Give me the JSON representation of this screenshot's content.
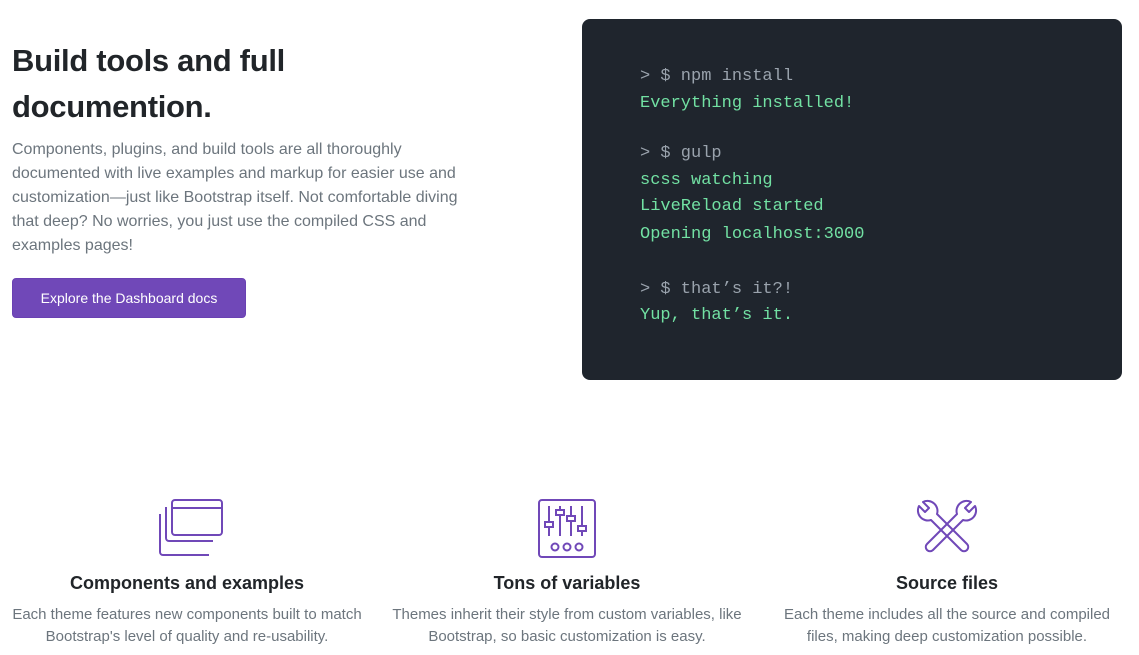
{
  "hero": {
    "title": "Build tools and full documention.",
    "description": "Components, plugins, and build tools are all thoroughly documented with live examples and markup for easier use and customization—just like Bootstrap itself. Not comfortable diving that deep? No worries, you just use the compiled CSS and examples pages!",
    "button_label": "Explore the Dashboard docs"
  },
  "terminal": {
    "lines": [
      {
        "kind": "cmd",
        "text": "> $ npm install"
      },
      {
        "kind": "out",
        "text": "Everything installed!"
      },
      {
        "kind": "cmd",
        "text": "> $ gulp"
      },
      {
        "kind": "out",
        "text": "scss watching"
      },
      {
        "kind": "out",
        "text": "LiveReload started"
      },
      {
        "kind": "out",
        "text": "Opening localhost:3000"
      },
      {
        "kind": "cmd",
        "text": "> $ that’s it?!"
      },
      {
        "kind": "out",
        "text": "Yup, that’s it."
      }
    ]
  },
  "features": [
    {
      "icon": "stacked-windows-icon",
      "title": "Components and examples",
      "text": "Each theme features new components built to match Bootstrap's level of quality and re-usability."
    },
    {
      "icon": "sliders-icon",
      "title": "Tons of variables",
      "text": "Themes inherit their style from custom variables, like Bootstrap, so basic customization is easy."
    },
    {
      "icon": "tools-icon",
      "title": "Source files",
      "text": "Each theme includes all the source and compiled files, making deep customization possible."
    }
  ],
  "colors": {
    "accent": "#7048b8",
    "terminal_bg": "#1f252d",
    "terminal_cmd": "#9aa3ad",
    "terminal_out": "#72e1a3"
  }
}
